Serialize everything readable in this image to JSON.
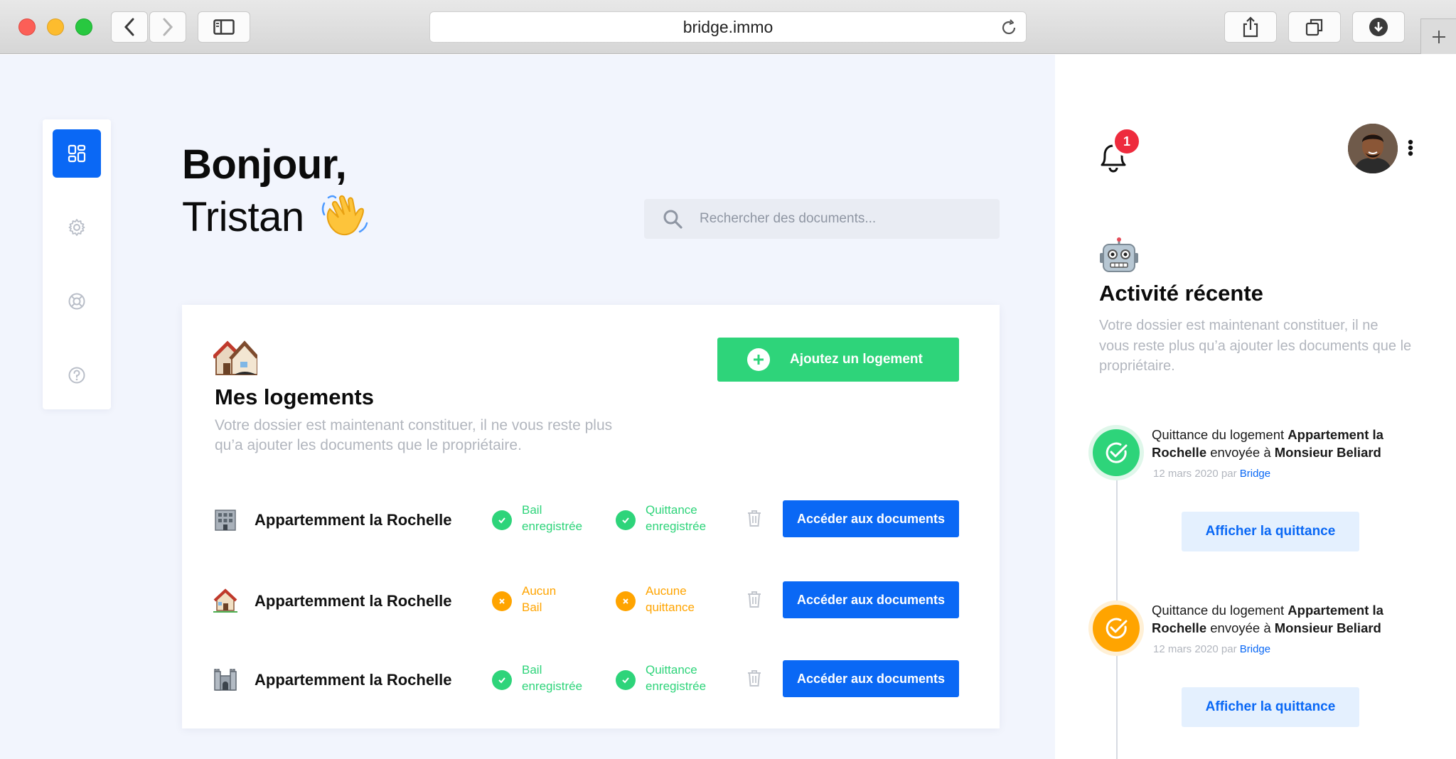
{
  "browser": {
    "url": "bridge.immo"
  },
  "sidebar": {
    "items": [
      {
        "name": "dashboard",
        "icon": "dashboard-icon",
        "active": true
      },
      {
        "name": "settings",
        "icon": "gear-icon",
        "active": false
      },
      {
        "name": "support",
        "icon": "lifebuoy-icon",
        "active": false
      },
      {
        "name": "help",
        "icon": "question-icon",
        "active": false
      }
    ]
  },
  "greeting": {
    "line1": "Bonjour,",
    "line2": "Tristan",
    "emoji": "waving-hand-icon"
  },
  "search": {
    "placeholder": "Rechercher des documents..."
  },
  "logements": {
    "title": "Mes logements",
    "subtitle": "Votre dossier est maintenant constituer, il ne vous reste plus qu’a ajouter les documents que le propriétaire.",
    "add_label": "Ajoutez un logement",
    "rows": [
      {
        "icon": "building-icon",
        "name": "Appartemment la Rochelle",
        "bail": {
          "line1": "Bail",
          "line2": "enregistrée",
          "status": "ok"
        },
        "quittance": {
          "line1": "Quittance",
          "line2": "enregistrée",
          "status": "ok"
        },
        "action": "Accéder aux documents"
      },
      {
        "icon": "house-icon",
        "name": "Appartemment la Rochelle",
        "bail": {
          "line1": "Aucun",
          "line2": "Bail",
          "status": "warn"
        },
        "quittance": {
          "line1": "Aucune",
          "line2": "quittance",
          "status": "warn"
        },
        "action": "Accéder aux documents"
      },
      {
        "icon": "castle-icon",
        "name": "Appartemment la Rochelle",
        "bail": {
          "line1": "Bail",
          "line2": "enregistrée",
          "status": "ok"
        },
        "quittance": {
          "line1": "Quittance",
          "line2": "enregistrée",
          "status": "ok"
        },
        "action": "Accéder aux documents"
      }
    ]
  },
  "notifications": {
    "count": "1"
  },
  "activity": {
    "title": "Activité récente",
    "subtitle": "Votre dossier est maintenant constituer, il ne vous reste plus qu’a ajouter les documents que le propriétaire.",
    "items": [
      {
        "status": "green",
        "text_prefix": "Quittance du logement ",
        "text_bold1": "Appartement la Rochelle",
        "text_mid": " envoyée à ",
        "text_bold2": "Monsieur Beliard",
        "date": "12 mars 2020 par ",
        "by": "Bridge",
        "button": "Afficher la quittance"
      },
      {
        "status": "orange",
        "text_prefix": "Quittance du logement ",
        "text_bold1": "Appartement la Rochelle",
        "text_mid": " envoyée à ",
        "text_bold2": "Monsieur Beliard",
        "date": "12 mars 2020 par ",
        "by": "Bridge",
        "button": "Afficher la quittance"
      }
    ]
  },
  "colors": {
    "primary": "#0a68f5",
    "success": "#2ed47a",
    "warning": "#ffa400",
    "danger": "#ee2b3d",
    "background": "#f2f5fd"
  }
}
